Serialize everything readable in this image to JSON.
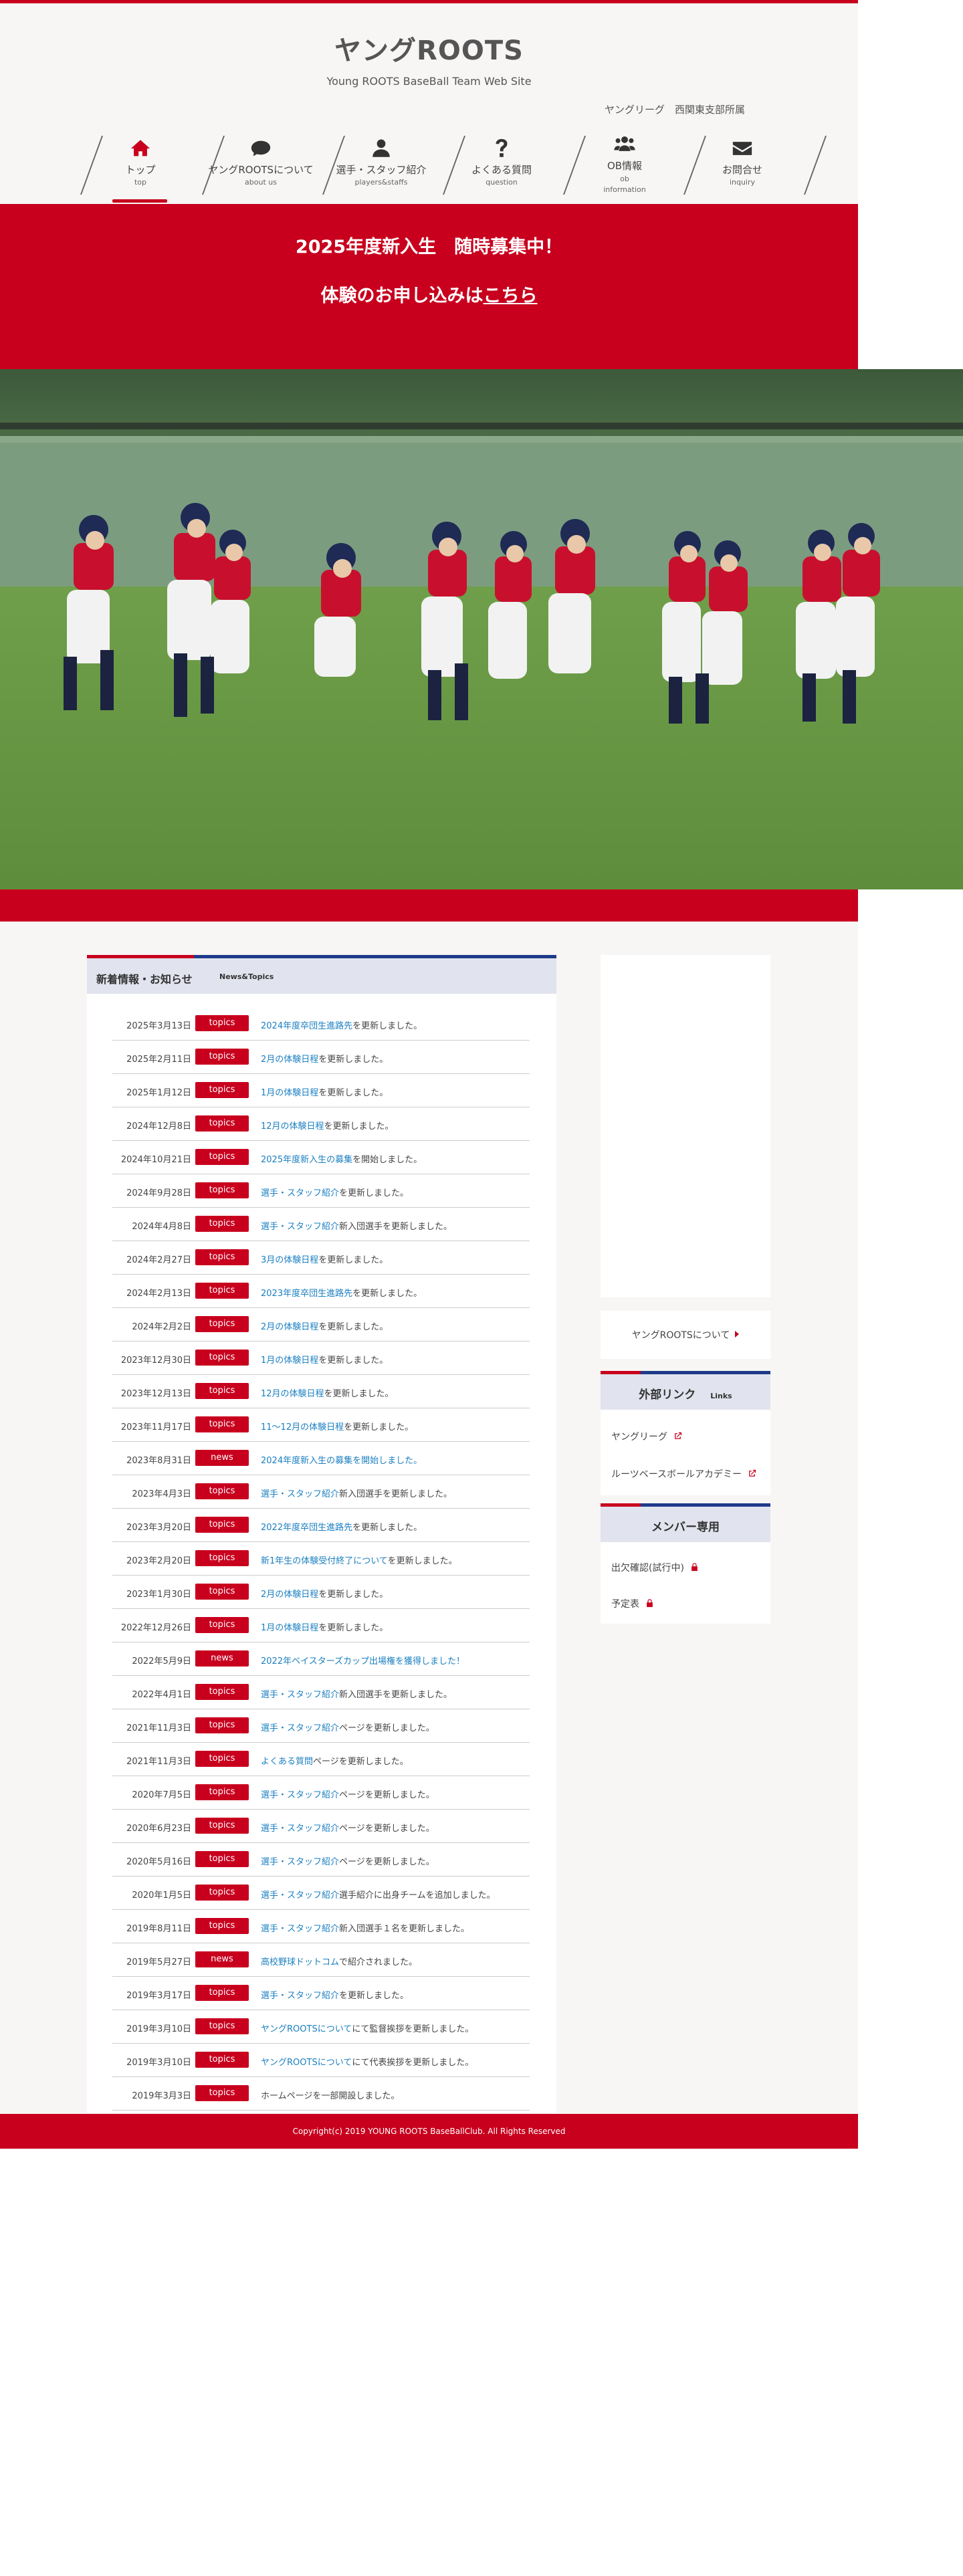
{
  "header": {
    "title": "ヤングROOTS",
    "subtitle": "Young ROOTS BaseBall Team Web Site",
    "league_note": "ヤングリーグ　西関東支部所属"
  },
  "nav": [
    {
      "label": "トップ",
      "en": "top",
      "icon": "home-icon"
    },
    {
      "label": "ヤングROOTSについて",
      "en": "about us",
      "icon": "comment-icon"
    },
    {
      "label": "選手・スタッフ紹介",
      "en": "players&staffs",
      "icon": "user-icon"
    },
    {
      "label": "よくある質問",
      "en": "question",
      "icon": "question-icon"
    },
    {
      "label": "OB情報",
      "en": "ob\ninformation",
      "icon": "users-icon"
    },
    {
      "label": "お問合せ",
      "en": "inquiry",
      "icon": "envelope-icon"
    }
  ],
  "banner": {
    "line1": "2025年度新入生　随時募集中！",
    "line2_prefix": "体験のお申し込みは",
    "line2_link": "こちら"
  },
  "news": {
    "title": "新着情報・お知らせ",
    "title_en": "News&Topics",
    "items": [
      {
        "date": "2025年3月13日",
        "badge": "topics",
        "link": "2024年度卒団生進路先",
        "rest": "を更新しました。"
      },
      {
        "date": "2025年2月11日",
        "badge": "topics",
        "link": "2月の体験日程",
        "rest": "を更新しました。"
      },
      {
        "date": "2025年1月12日",
        "badge": "topics",
        "link": "1月の体験日程",
        "rest": "を更新しました。"
      },
      {
        "date": "2024年12月8日",
        "badge": "topics",
        "link": "12月の体験日程",
        "rest": "を更新しました。"
      },
      {
        "date": "2024年10月21日",
        "badge": "topics",
        "link": "2025年度新入生の募集",
        "rest": "を開始しました。"
      },
      {
        "date": "2024年9月28日",
        "badge": "topics",
        "link": "選手・スタッフ紹介",
        "rest": "を更新しました。"
      },
      {
        "date": "2024年4月8日",
        "badge": "topics",
        "link": "選手・スタッフ紹介",
        "rest": "新入団選手を更新しました。"
      },
      {
        "date": "2024年2月27日",
        "badge": "topics",
        "link": "3月の体験日程",
        "rest": "を更新しました。"
      },
      {
        "date": "2024年2月13日",
        "badge": "topics",
        "link": "2023年度卒団生進路先",
        "rest": "を更新しました。"
      },
      {
        "date": "2024年2月2日",
        "badge": "topics",
        "link": "2月の体験日程",
        "rest": "を更新しました。"
      },
      {
        "date": "2023年12月30日",
        "badge": "topics",
        "link": "1月の体験日程",
        "rest": "を更新しました。"
      },
      {
        "date": "2023年12月13日",
        "badge": "topics",
        "link": "12月の体験日程",
        "rest": "を更新しました。"
      },
      {
        "date": "2023年11月17日",
        "badge": "topics",
        "link": "11～12月の体験日程",
        "rest": "を更新しました。"
      },
      {
        "date": "2023年8月31日",
        "badge": "news",
        "link": "2024年度新入生の募集を開始しました。",
        "rest": ""
      },
      {
        "date": "2023年4月3日",
        "badge": "topics",
        "link": "選手・スタッフ紹介",
        "rest": "新入団選手を更新しました。"
      },
      {
        "date": "2023年3月20日",
        "badge": "topics",
        "link": "2022年度卒団生進路先",
        "rest": "を更新しました。"
      },
      {
        "date": "2023年2月20日",
        "badge": "topics",
        "link": "新1年生の体験受付終了について",
        "rest": "を更新しました。"
      },
      {
        "date": "2023年1月30日",
        "badge": "topics",
        "link": "2月の体験日程",
        "rest": "を更新しました。"
      },
      {
        "date": "2022年12月26日",
        "badge": "topics",
        "link": "1月の体験日程",
        "rest": "を更新しました。"
      },
      {
        "date": "2022年5月9日",
        "badge": "news",
        "link": "2022年ベイスターズカップ出場権を獲得しました！",
        "rest": ""
      },
      {
        "date": "2022年4月1日",
        "badge": "topics",
        "link": "選手・スタッフ紹介",
        "rest": "新入団選手を更新しました。"
      },
      {
        "date": "2021年11月3日",
        "badge": "topics",
        "link": "選手・スタッフ紹介",
        "rest": "ページを更新しました。"
      },
      {
        "date": "2021年11月3日",
        "badge": "topics",
        "link": "よくある質問",
        "rest": "ページを更新しました。"
      },
      {
        "date": "2020年7月5日",
        "badge": "topics",
        "link": "選手・スタッフ紹介",
        "rest": "ページを更新しました。"
      },
      {
        "date": "2020年6月23日",
        "badge": "topics",
        "link": "選手・スタッフ紹介",
        "rest": "ページを更新しました。"
      },
      {
        "date": "2020年5月16日",
        "badge": "topics",
        "link": "選手・スタッフ紹介",
        "rest": "ページを更新しました。"
      },
      {
        "date": "2020年1月5日",
        "badge": "topics",
        "link": "選手・スタッフ紹介",
        "rest": "選手紹介に出身チームを追加しました。"
      },
      {
        "date": "2019年8月11日",
        "badge": "topics",
        "link": "選手・スタッフ紹介",
        "rest": "新入団選手１名を更新しました。"
      },
      {
        "date": "2019年5月27日",
        "badge": "news",
        "link": "高校野球ドットコム",
        "rest": "で紹介されました。"
      },
      {
        "date": "2019年3月17日",
        "badge": "topics",
        "link": "選手・スタッフ紹介",
        "rest": "を更新しました。"
      },
      {
        "date": "2019年3月10日",
        "badge": "topics",
        "link": "ヤングROOTSについて",
        "rest": "にて監督挨拶を更新しました。"
      },
      {
        "date": "2019年3月10日",
        "badge": "topics",
        "link": "ヤングROOTSについて",
        "rest": "にて代表挨拶を更新しました。"
      },
      {
        "date": "2019年3月3日",
        "badge": "topics",
        "link": "",
        "rest": "ホームページを一部開設しました。"
      }
    ]
  },
  "sidebar": {
    "about_link": "ヤングROOTSについて",
    "links_title": "外部リンク",
    "links_title_en": "Links",
    "links": [
      "ヤングリーグ",
      "ルーツベースボールアカデミー"
    ],
    "member_title": "メンバー専用",
    "member_links": [
      "出欠確認(試行中)",
      "予定表"
    ]
  },
  "footer": {
    "copyright": "Copyright(c) 2019 YOUNG ROOTS BaseBallClub. All Rights Reserved"
  },
  "colors": {
    "accent": "#c8001e",
    "navy": "#1e3a8a",
    "link": "#1a7fc1"
  }
}
